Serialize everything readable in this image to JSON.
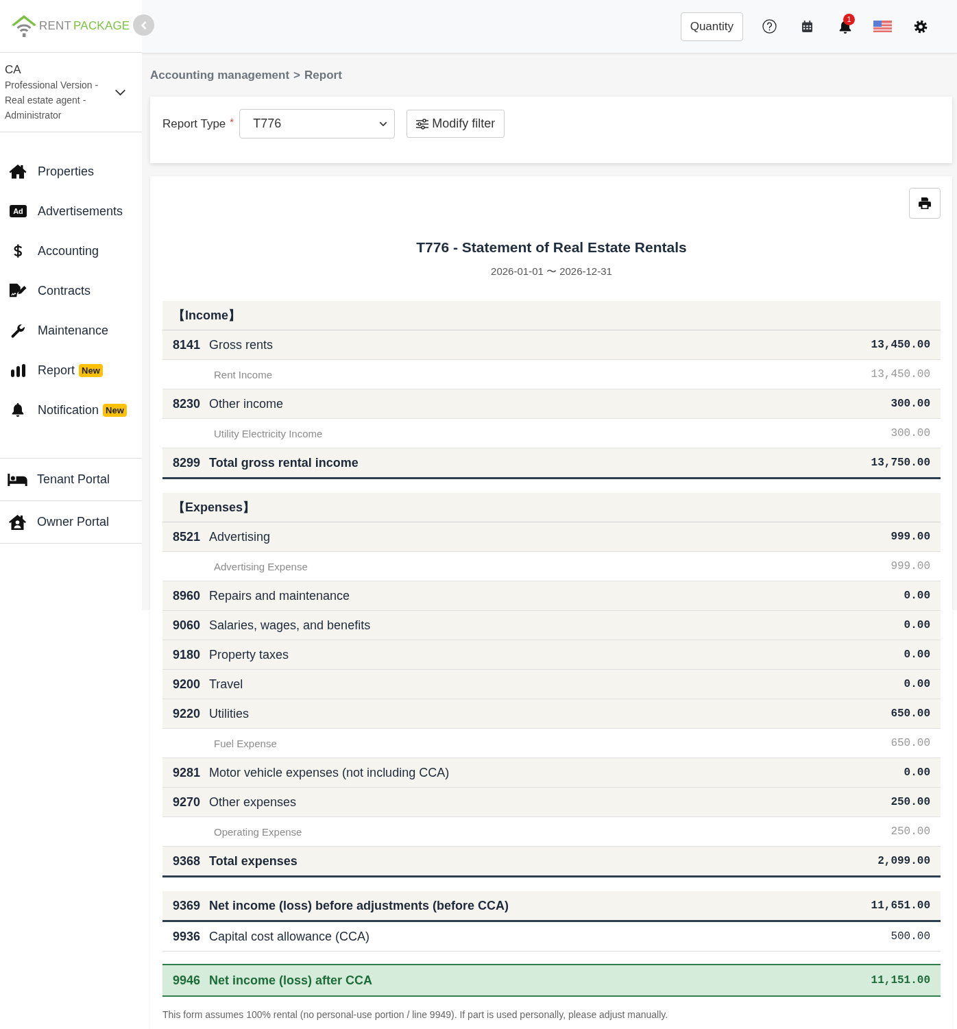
{
  "brand": {
    "first": "RENT",
    "second": "PACKAGE"
  },
  "profile": {
    "region": "CA",
    "role": "Professional Version - Real estate agent - Administrator"
  },
  "sidebar": {
    "items": [
      {
        "label": "Properties"
      },
      {
        "label": "Advertisements",
        "icon_text": "Ad"
      },
      {
        "label": "Accounting"
      },
      {
        "label": "Contracts"
      },
      {
        "label": "Maintenance"
      },
      {
        "label": "Report",
        "badge": "New"
      },
      {
        "label": "Notification",
        "badge": "New"
      }
    ],
    "portals": [
      {
        "label": "Tenant Portal"
      },
      {
        "label": "Owner Portal"
      }
    ]
  },
  "topbar": {
    "quantity_button": "Quantity",
    "notification_count": "1"
  },
  "breadcrumb": {
    "items": [
      "Accounting management",
      "Report"
    ],
    "separator": ">"
  },
  "filter": {
    "label": "Report Type",
    "required_mark": "*",
    "value": "T776",
    "button": "Modify filter"
  },
  "report": {
    "title": "T776 - Statement of Real Estate Rentals",
    "period": "2026-01-01 〜 2026-12-31",
    "rows": [
      {
        "kind": "section",
        "name": "【Income】"
      },
      {
        "kind": "account",
        "code": "8141",
        "name": "Gross rents",
        "amount": "13,450.00"
      },
      {
        "kind": "detail",
        "name": "Rent Income",
        "amount": "13,450.00"
      },
      {
        "kind": "account",
        "code": "8230",
        "name": "Other income",
        "amount": "300.00"
      },
      {
        "kind": "detail",
        "name": "Utility Electricity Income",
        "amount": "300.00"
      },
      {
        "kind": "total",
        "code": "8299",
        "name": "Total gross rental income",
        "amount": "13,750.00"
      },
      {
        "kind": "section",
        "name": "【Expenses】"
      },
      {
        "kind": "account",
        "code": "8521",
        "name": "Advertising",
        "amount": "999.00"
      },
      {
        "kind": "detail",
        "name": "Advertising Expense",
        "amount": "999.00"
      },
      {
        "kind": "account",
        "code": "8960",
        "name": "Repairs and maintenance",
        "amount": "0.00"
      },
      {
        "kind": "account",
        "code": "9060",
        "name": "Salaries, wages, and benefits",
        "amount": "0.00"
      },
      {
        "kind": "account",
        "code": "9180",
        "name": "Property taxes",
        "amount": "0.00"
      },
      {
        "kind": "account",
        "code": "9200",
        "name": "Travel",
        "amount": "0.00"
      },
      {
        "kind": "account",
        "code": "9220",
        "name": "Utilities",
        "amount": "650.00"
      },
      {
        "kind": "detail",
        "name": "Fuel Expense",
        "amount": "650.00"
      },
      {
        "kind": "account",
        "code": "9281",
        "name": "Motor vehicle expenses (not including CCA)",
        "amount": "0.00"
      },
      {
        "kind": "account",
        "code": "9270",
        "name": "Other expenses",
        "amount": "250.00"
      },
      {
        "kind": "detail",
        "name": "Operating Expense",
        "amount": "250.00"
      },
      {
        "kind": "total",
        "code": "9368",
        "name": "Total expenses",
        "amount": "2,099.00"
      },
      {
        "kind": "net",
        "code": "9369",
        "name": "Net income (loss) before adjustments (before CCA)",
        "amount": "11,651.00"
      },
      {
        "kind": "plain",
        "code": "9936",
        "name": "Capital cost allowance (CCA)",
        "amount": "500.00"
      },
      {
        "kind": "result",
        "code": "9946",
        "name": "Net income (loss) after CCA",
        "amount": "11,151.00"
      }
    ],
    "footnote": "This form assumes 100% rental (no personal-use portion / line 9949). If part is used personally, please adjust manually."
  }
}
